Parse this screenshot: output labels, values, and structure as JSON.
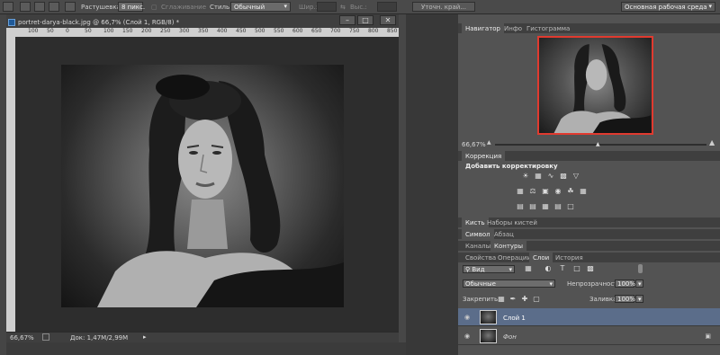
{
  "options_bar": {
    "feather_label": "Растушевка:",
    "feather_value": "8 пикс.",
    "antialias_label": "Сглаживание",
    "style_label": "Стиль:",
    "style_value": "Обычный",
    "width_label": "Шир.:",
    "height_label": "Выс.:",
    "refine_edge_button": "Уточн. край...",
    "workspace_value": "Основная рабочая среда"
  },
  "document": {
    "tab_title": "portret-darya-black.jpg @ 66,7% (Слой 1, RGB/8) *",
    "ruler_ticks": [
      "100",
      "50",
      "0",
      "50",
      "100",
      "150",
      "200",
      "250",
      "300",
      "350",
      "400",
      "450",
      "500",
      "550",
      "600",
      "650",
      "700",
      "750",
      "800",
      "850"
    ],
    "zoom": "66,67%",
    "doc_info": "Док: 1,47M/2,99M"
  },
  "navigator": {
    "tabs": [
      "Навигатор",
      "Инфо",
      "Гистограмма"
    ],
    "zoom": "66,67%"
  },
  "adjustments": {
    "tabs": [
      "Коррекция"
    ],
    "title": "Добавить корректировку"
  },
  "brush": {
    "tabs": [
      "Кисть",
      "Наборы кистей"
    ]
  },
  "character": {
    "tabs": [
      "Символ",
      "Абзац"
    ]
  },
  "channels": {
    "tabs": [
      "Каналы",
      "Контуры"
    ]
  },
  "layers_panel": {
    "tabs": [
      "Свойства",
      "Операции",
      "Слои",
      "История"
    ],
    "filter_kind": "Вид",
    "blend_mode": "Обычные",
    "opacity_label": "Непрозрачность:",
    "opacity_value": "100%",
    "lock_label": "Закрепить:",
    "fill_label": "Заливка:",
    "fill_value": "100%",
    "layers": [
      {
        "name": "Слой 1",
        "selected": true
      },
      {
        "name": "Фон",
        "selected": false
      }
    ]
  },
  "colors": {
    "selected_layer": "#5b6d8a",
    "navigator_frame": "#e03a2f",
    "ps_badge": "#1f5a99"
  }
}
